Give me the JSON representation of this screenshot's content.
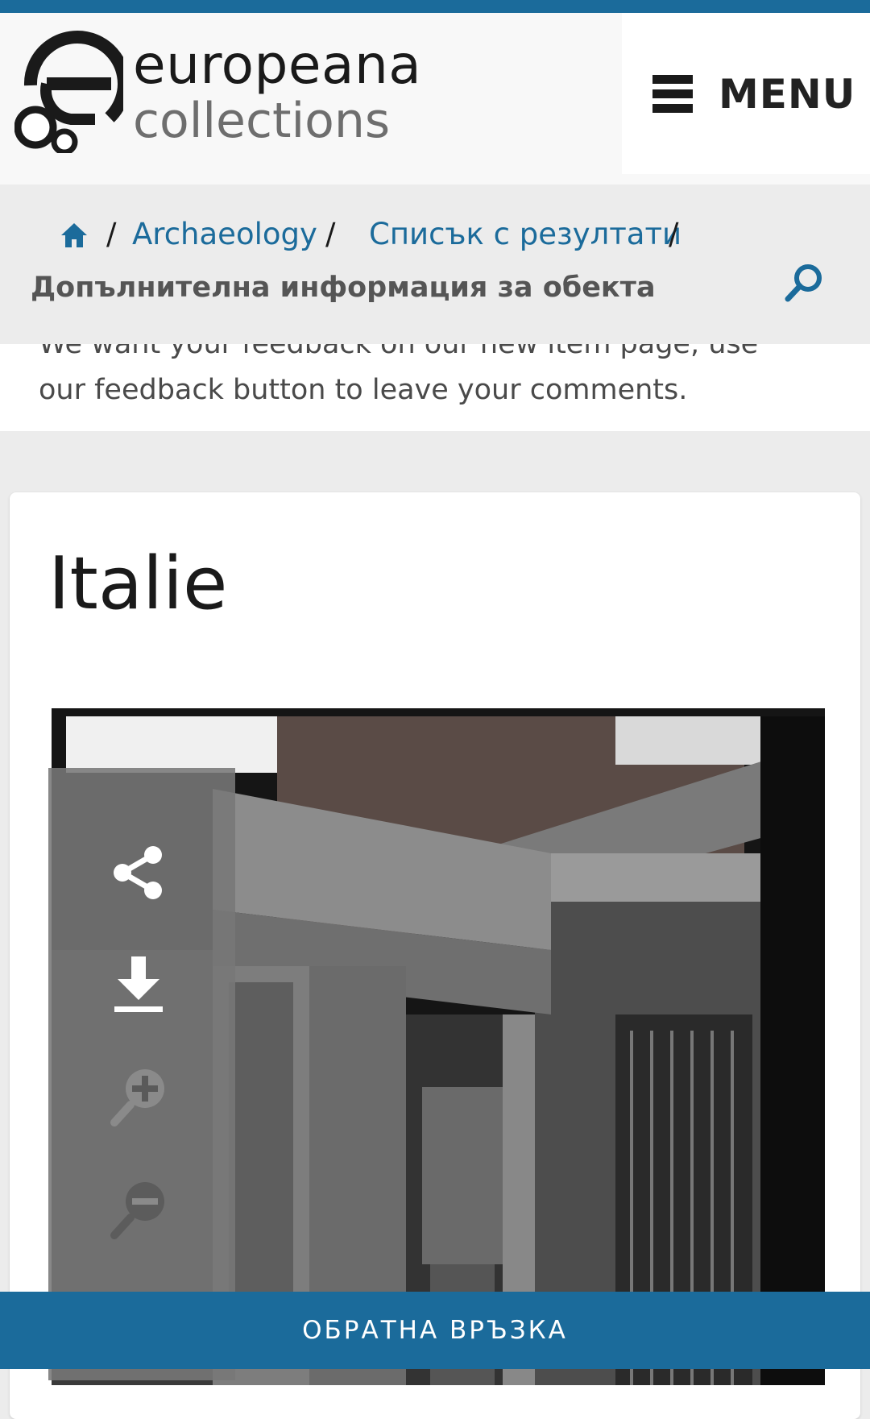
{
  "header": {
    "logo_word1": "europeana",
    "logo_word2": "collections",
    "menu_label": "MENU"
  },
  "breadcrumb": {
    "items": [
      {
        "label": "Archaeology"
      },
      {
        "label": "Списък с резултати"
      }
    ],
    "separator": "/",
    "current": "Допълнителна информация за обекта"
  },
  "notice": {
    "text": "We want your feedback on our new item page, use our feedback button to leave your comments."
  },
  "item": {
    "title": "Italie"
  },
  "tools": {
    "icons": [
      "share-icon",
      "download-icon",
      "zoom-in-icon",
      "zoom-out-icon"
    ]
  },
  "feedback_button": {
    "label": "ОБРАТНА ВРЪЗКА"
  },
  "colors": {
    "brand_blue": "#1b6b9b",
    "background": "#ececec",
    "toolbar_overlay": "#787878"
  }
}
